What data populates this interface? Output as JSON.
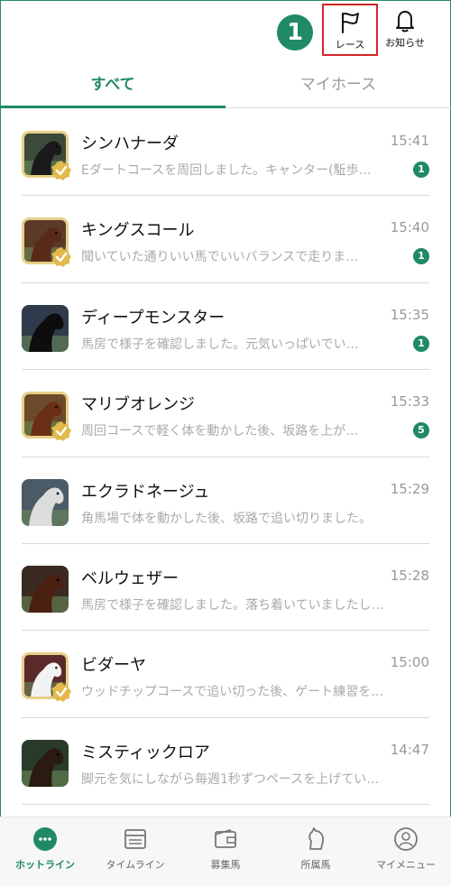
{
  "header": {
    "step_number": "1",
    "race_label": "レース",
    "notice_label": "お知らせ"
  },
  "tabs": [
    {
      "label": "すべて",
      "active": true
    },
    {
      "label": "マイホース",
      "active": false
    }
  ],
  "colors": {
    "accent": "#1f8a63",
    "highlight": "#d6262b",
    "gold": "#e8cf86"
  },
  "messages": [
    {
      "name": "シンハナーダ",
      "time": "15:41",
      "preview": "Eダートコースを周回しました。キャンター(駈歩…",
      "count": "1",
      "verified": true
    },
    {
      "name": "キングスコール",
      "time": "15:40",
      "preview": "聞いていた通りいい馬でいいバランスで走りま…",
      "count": "1",
      "verified": true
    },
    {
      "name": "ディープモンスター",
      "time": "15:35",
      "preview": "馬房で様子を確認しました。元気いっぱいでい…",
      "count": "1",
      "verified": false
    },
    {
      "name": "マリブオレンジ",
      "time": "15:33",
      "preview": "周回コースで軽く体を動かした後、坂路を上が…",
      "count": "5",
      "verified": true
    },
    {
      "name": "エクラドネージュ",
      "time": "15:29",
      "preview": "角馬場で体を動かした後、坂路で追い切りました。",
      "count": "",
      "verified": false
    },
    {
      "name": "ベルウェザー",
      "time": "15:28",
      "preview": "馬房で様子を確認しました。落ち着いていましたし…",
      "count": "",
      "verified": false
    },
    {
      "name": "ビダーヤ",
      "time": "15:00",
      "preview": "ウッドチップコースで追い切った後、ゲート練習を…",
      "count": "",
      "verified": true
    },
    {
      "name": "ミスティックロア",
      "time": "14:47",
      "preview": "脚元を気にしながら毎週1秒ずつペースを上げてい…",
      "count": "",
      "verified": false
    }
  ],
  "bottom_nav": [
    {
      "label": "ホットライン",
      "icon": "chat-bubble-icon",
      "active": true
    },
    {
      "label": "タイムライン",
      "icon": "timeline-icon",
      "active": false
    },
    {
      "label": "募集馬",
      "icon": "wallet-icon",
      "active": false
    },
    {
      "label": "所属馬",
      "icon": "horse-icon",
      "active": false
    },
    {
      "label": "マイメニュー",
      "icon": "user-icon",
      "active": false
    }
  ]
}
